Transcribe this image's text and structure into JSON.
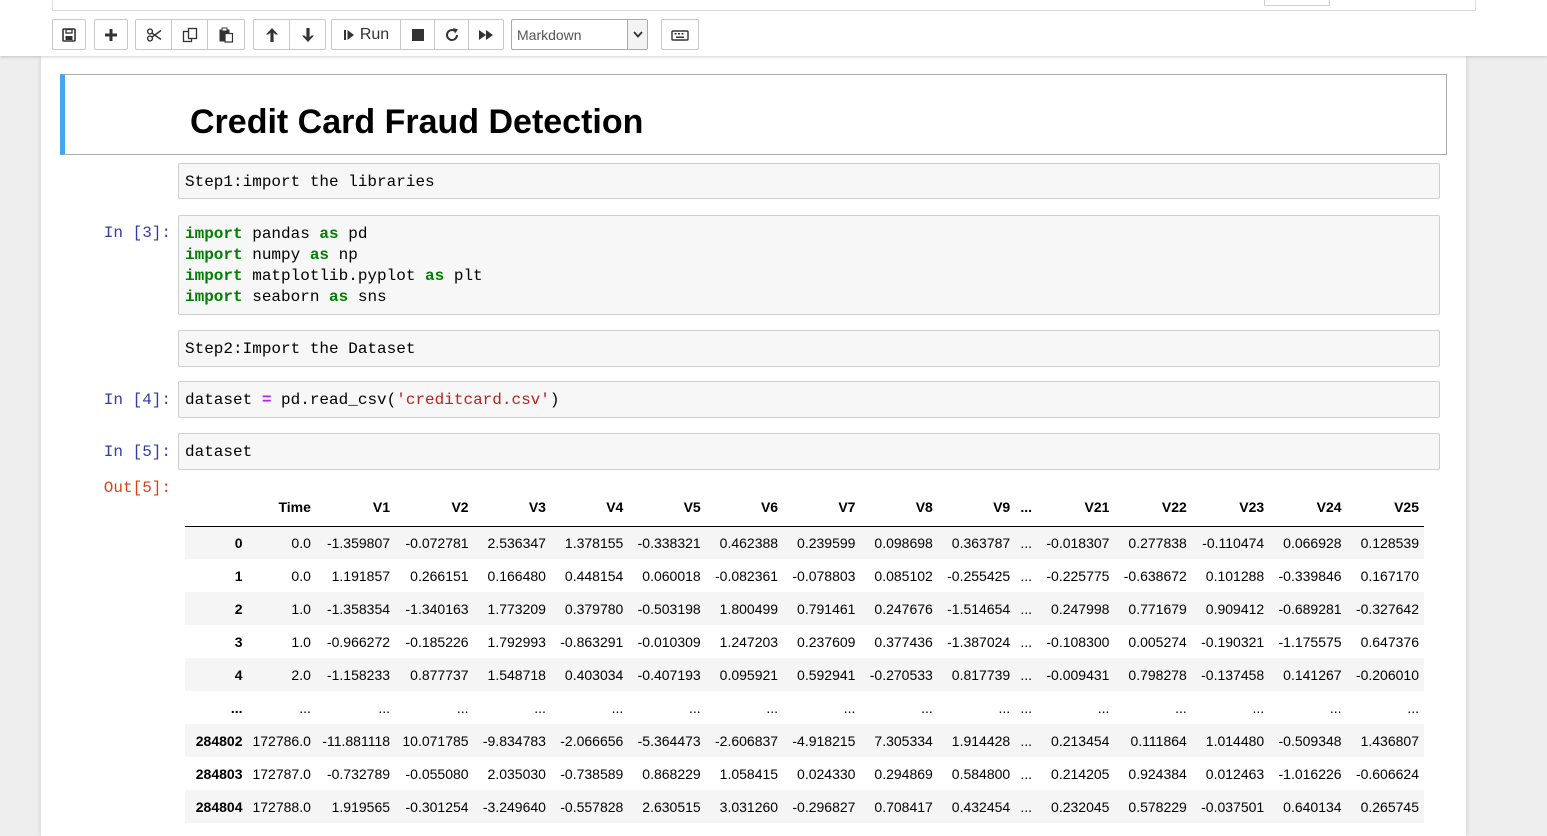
{
  "toolbar": {
    "run_label": "Run",
    "cell_type": "Markdown",
    "icons": [
      "save-icon",
      "plus-icon",
      "cut-icon",
      "copy-icon",
      "paste-icon",
      "move-up-icon",
      "move-down-icon",
      "run-icon",
      "stop-icon",
      "restart-icon",
      "fast-forward-icon",
      "keyboard-icon"
    ]
  },
  "cells": {
    "heading": "Credit Card Fraud Detection",
    "md_step1": "Step1:import the libraries",
    "prompt3": "In [3]:",
    "code3": {
      "line1": {
        "kw": "import",
        "mid": " pandas ",
        "kw2": "as",
        "end": " pd"
      },
      "line2": {
        "kw": "import",
        "mid": " numpy ",
        "kw2": "as",
        "end": " np"
      },
      "line3": {
        "kw": "import",
        "mid": " matplotlib.pyplot ",
        "kw2": "as",
        "end": " plt"
      },
      "line4": {
        "kw": "import",
        "mid": " seaborn ",
        "kw2": "as",
        "end": " sns"
      }
    },
    "md_step2": "Step2:Import the Dataset",
    "prompt4": "In [4]:",
    "code4": {
      "a": "dataset ",
      "op": "=",
      "b": " pd.read_csv(",
      "str": "'creditcard.csv'",
      "c": ")"
    },
    "prompt5": "In [5]:",
    "code5": "dataset",
    "out5": "Out[5]:"
  },
  "dataframe": {
    "columns": [
      "",
      "Time",
      "V1",
      "V2",
      "V3",
      "V4",
      "V5",
      "V6",
      "V7",
      "V8",
      "V9",
      "...",
      "V21",
      "V22",
      "V23",
      "V24",
      "V25"
    ],
    "rows": [
      [
        "0",
        "0.0",
        "-1.359807",
        "-0.072781",
        "2.536347",
        "1.378155",
        "-0.338321",
        "0.462388",
        "0.239599",
        "0.098698",
        "0.363787",
        "...",
        "-0.018307",
        "0.277838",
        "-0.110474",
        "0.066928",
        "0.128539"
      ],
      [
        "1",
        "0.0",
        "1.191857",
        "0.266151",
        "0.166480",
        "0.448154",
        "0.060018",
        "-0.082361",
        "-0.078803",
        "0.085102",
        "-0.255425",
        "...",
        "-0.225775",
        "-0.638672",
        "0.101288",
        "-0.339846",
        "0.167170"
      ],
      [
        "2",
        "1.0",
        "-1.358354",
        "-1.340163",
        "1.773209",
        "0.379780",
        "-0.503198",
        "1.800499",
        "0.791461",
        "0.247676",
        "-1.514654",
        "...",
        "0.247998",
        "0.771679",
        "0.909412",
        "-0.689281",
        "-0.327642"
      ],
      [
        "3",
        "1.0",
        "-0.966272",
        "-0.185226",
        "1.792993",
        "-0.863291",
        "-0.010309",
        "1.247203",
        "0.237609",
        "0.377436",
        "-1.387024",
        "...",
        "-0.108300",
        "0.005274",
        "-0.190321",
        "-1.175575",
        "0.647376"
      ],
      [
        "4",
        "2.0",
        "-1.158233",
        "0.877737",
        "1.548718",
        "0.403034",
        "-0.407193",
        "0.095921",
        "0.592941",
        "-0.270533",
        "0.817739",
        "...",
        "-0.009431",
        "0.798278",
        "-0.137458",
        "0.141267",
        "-0.206010"
      ],
      [
        "...",
        "...",
        "...",
        "...",
        "...",
        "...",
        "...",
        "...",
        "...",
        "...",
        "...",
        "...",
        "...",
        "...",
        "...",
        "...",
        "..."
      ],
      [
        "284802",
        "172786.0",
        "-11.881118",
        "10.071785",
        "-9.834783",
        "-2.066656",
        "-5.364473",
        "-2.606837",
        "-4.918215",
        "7.305334",
        "1.914428",
        "...",
        "0.213454",
        "0.111864",
        "1.014480",
        "-0.509348",
        "1.436807"
      ],
      [
        "284803",
        "172787.0",
        "-0.732789",
        "-0.055080",
        "2.035030",
        "-0.738589",
        "0.868229",
        "1.058415",
        "0.024330",
        "0.294869",
        "0.584800",
        "...",
        "0.214205",
        "0.924384",
        "0.012463",
        "-1.016226",
        "-0.606624"
      ],
      [
        "284804",
        "172788.0",
        "1.919565",
        "-0.301254",
        "-3.249640",
        "-0.557828",
        "2.630515",
        "3.031260",
        "-0.296827",
        "0.708417",
        "0.432454",
        "...",
        "0.232045",
        "0.578229",
        "-0.037501",
        "0.640134",
        "0.265745"
      ]
    ]
  }
}
